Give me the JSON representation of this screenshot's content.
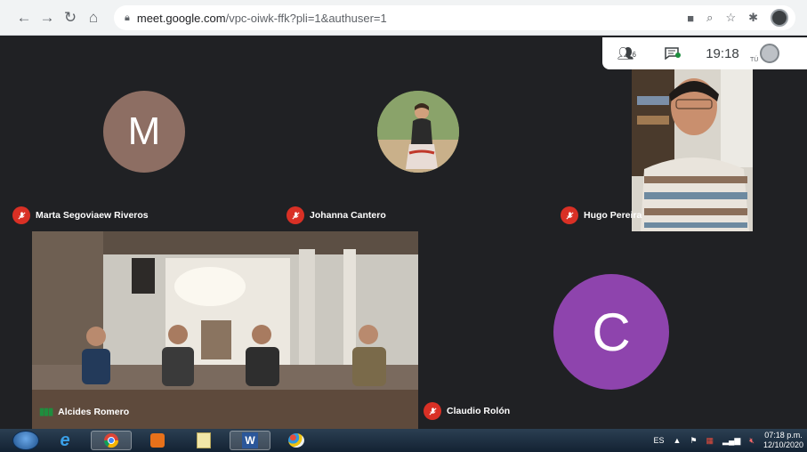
{
  "browser": {
    "url_host": "meet.google.com",
    "url_path": "/vpc-oiwk-ffk?pli=1&authuser=1"
  },
  "meeting": {
    "people_count": "6",
    "time": "19:18",
    "you_label": "TÚ"
  },
  "participants": [
    {
      "name": "Marta Segoviaew Riveros",
      "initial": "M",
      "avatar_color": "#8d6e63",
      "muted": true
    },
    {
      "name": "Johanna Cantero",
      "muted": true
    },
    {
      "name": "Hugo Pereira",
      "muted": true
    },
    {
      "name": "Alcides Romero",
      "muted": false
    },
    {
      "name": "Claudio Rolón",
      "initial": "C",
      "avatar_color": "#8e44ad",
      "muted": true
    }
  ],
  "taskbar": {
    "language": "ES",
    "time": "07:18 p.m.",
    "date": "12/10/2020",
    "word_label": "W"
  },
  "colors": {
    "mic_off": "#d93025",
    "speaking": "#1e8e3e"
  }
}
